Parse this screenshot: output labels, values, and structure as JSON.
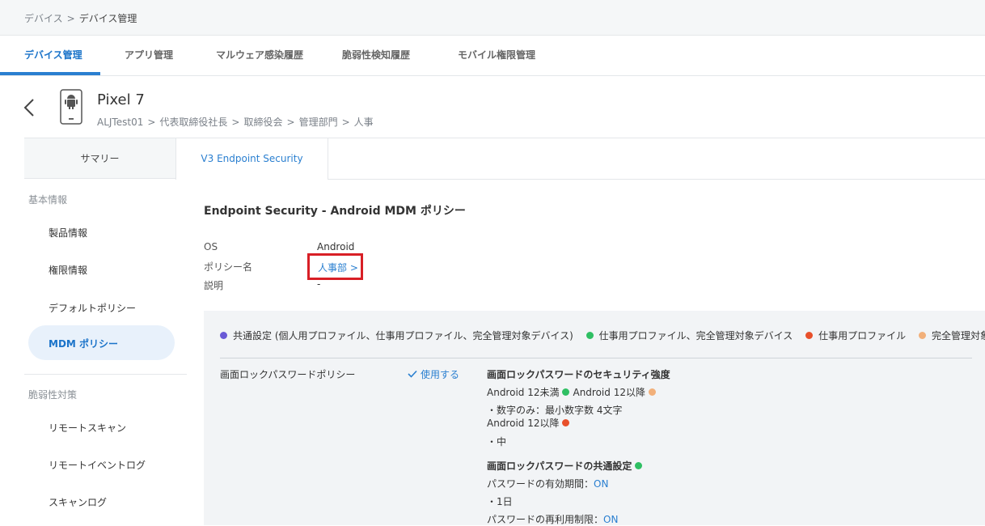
{
  "breadcrumb": {
    "parent": "デバイス",
    "separator": ">",
    "current": "デバイス管理"
  },
  "tabs": [
    {
      "label": "デバイス管理"
    },
    {
      "label": "アプリ管理"
    },
    {
      "label": "マルウェア感染履歴"
    },
    {
      "label": "脆弱性検知履歴"
    },
    {
      "label": "モバイル権限管理"
    }
  ],
  "device": {
    "name": "Pixel 7",
    "path": [
      "ALJTest01",
      "代表取締役社長",
      "取締役会",
      "管理部門",
      "人事"
    ],
    "path_separator": ">"
  },
  "subtabs": {
    "summary": "サマリー",
    "endpoint": "V3 Endpoint Security"
  },
  "sidebar": {
    "section1": "基本情報",
    "items1": [
      "製品情報",
      "権限情報",
      "デフォルトポリシー",
      "MDM ポリシー"
    ],
    "section2": "脆弱性対策",
    "items2": [
      "リモートスキャン",
      "リモートイベントログ",
      "スキャンログ"
    ]
  },
  "main": {
    "title": "Endpoint Security - Android MDM ポリシー",
    "os_label": "OS",
    "os_value": "Android",
    "policy_label": "ポリシー名",
    "policy_value": "人事部",
    "policy_chevron": ">",
    "desc_label": "説明",
    "desc_value": "-"
  },
  "legend": [
    {
      "label": "共通設定 (個人用プロファイル、仕事用プロファイル、完全管理対象デバイス)",
      "color": "#6a5ad6"
    },
    {
      "label": "仕事用プロファイル、完全管理対象デバイス",
      "color": "#2fbf63"
    },
    {
      "label": "仕事用プロファイル",
      "color": "#e8502b"
    },
    {
      "label": "完全管理対象デバイス",
      "color": "#f2b07a"
    }
  ],
  "policy_row": {
    "label": "画面ロックパスワードポリシー",
    "status": "使用する",
    "strength_title": "画面ロックパスワードのセキュリティ強度",
    "android_under12": "Android 12未満",
    "android_12plus_a": "Android 12以降",
    "digits_only": "・数字のみ：最小数字数 4文字",
    "android_12plus_b": "Android 12以降",
    "medium": "・中",
    "common_title": "画面ロックパスワードの共通設定",
    "expiry_label": "パスワードの有効期間：",
    "expiry_state": "ON",
    "expiry_value": "・1日",
    "reuse_label": "パスワードの再利用制限：",
    "reuse_state": "ON"
  }
}
